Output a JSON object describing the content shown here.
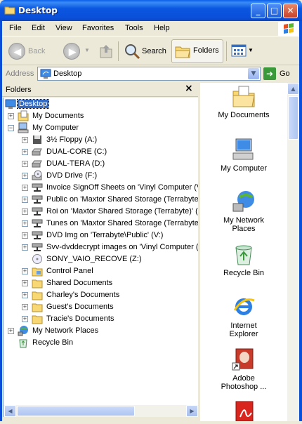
{
  "window": {
    "title": "Desktop"
  },
  "menu": [
    "File",
    "Edit",
    "View",
    "Favorites",
    "Tools",
    "Help"
  ],
  "toolbar": {
    "back": "Back",
    "search": "Search",
    "folders": "Folders"
  },
  "address": {
    "label": "Address",
    "value": "Desktop",
    "go": "Go"
  },
  "folders_pane": {
    "title": "Folders",
    "tree": [
      "Desktop",
      "My Documents",
      "My Computer",
      "3½ Floppy (A:)",
      "DUAL-CORE (C:)",
      "DUAL-TERA (D:)",
      "DVD Drive (F:)",
      "Invoice SignOff Sheets on 'Vinyl Computer (V",
      "Public on 'Maxtor Shared Storage (Terrabyte",
      "Roi on 'Maxtor Shared Storage (Terrabyte)' (",
      "Tunes on 'Maxtor Shared Storage (Terrabyte",
      "DVD Img on 'Terrabyte\\Public' (V:)",
      "Svv-dvddecrypt images on 'Vinyl Computer (V",
      "SONY_VAIO_RECOVE (Z:)",
      "Control Panel",
      "Shared Documents",
      "Charley's Documents",
      "Guest's Documents",
      "Tracie's Documents",
      "My Network Places",
      "Recycle Bin"
    ]
  },
  "desktop_items": [
    {
      "line1": "My Documents",
      "line2": ""
    },
    {
      "line1": "My Computer",
      "line2": ""
    },
    {
      "line1": "My Network",
      "line2": "Places"
    },
    {
      "line1": "Recycle Bin",
      "line2": ""
    },
    {
      "line1": "Internet",
      "line2": "Explorer"
    },
    {
      "line1": "Adobe",
      "line2": "Photoshop ..."
    }
  ],
  "colors": {
    "titlebar": "#0A4FD8",
    "selection": "#316AC5",
    "chrome": "#ECE9D8"
  }
}
